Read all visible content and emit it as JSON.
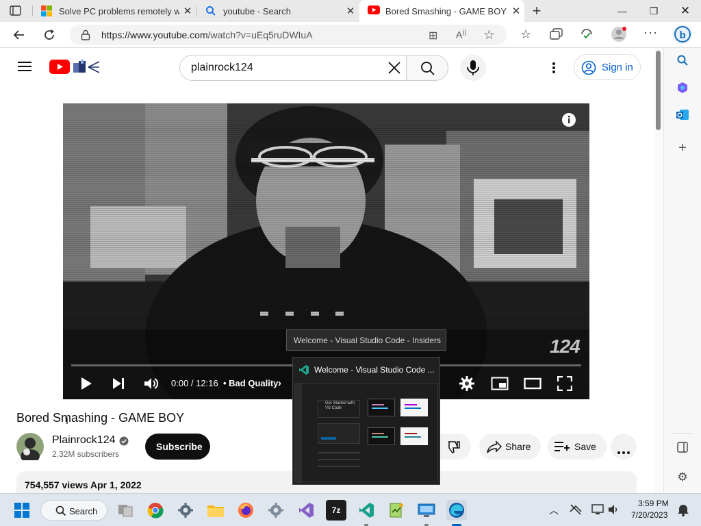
{
  "browser": {
    "tabs": [
      {
        "title": "Solve PC problems remotely with",
        "favicon": "microsoft-logo-icon"
      },
      {
        "title": "youtube - Search",
        "favicon": "bing-search-icon"
      },
      {
        "title": "Bored Smashing - GAME BOY - Y",
        "favicon": "youtube-icon",
        "active": true
      }
    ],
    "url_prefix": "https://www.youtube.com",
    "url_path": "/watch?v=uEq5ruDWIuA"
  },
  "youtube": {
    "search_query": "plainrock124",
    "signin_label": "Sign in"
  },
  "player": {
    "time": "0:00 / 12:16",
    "chapter": "• Bad Quality",
    "watermark": "124",
    "progress": 0.0
  },
  "tooltip": {
    "text": "Welcome - Visual Studio Code - Insiders"
  },
  "preview": {
    "title": "Welcome - Visual Studio Code ...",
    "get_started": "Get Started with VS Code"
  },
  "video": {
    "title": "Bored Smashing - GAME BOY",
    "channel": "Plainrock124",
    "subscribers": "2.32M subscribers",
    "subscribe_label": "Subscribe",
    "share_label": "Share",
    "save_label": "Save",
    "views": "754,557 views",
    "date": "Apr 1, 2022"
  },
  "taskbar": {
    "search_label": "Search",
    "time": "3:59 PM",
    "date": "7/20/2023"
  },
  "colors": {
    "youtube_red": "#ff0000",
    "link_blue": "#065fd4",
    "edge_blue": "#0f6cbd"
  }
}
